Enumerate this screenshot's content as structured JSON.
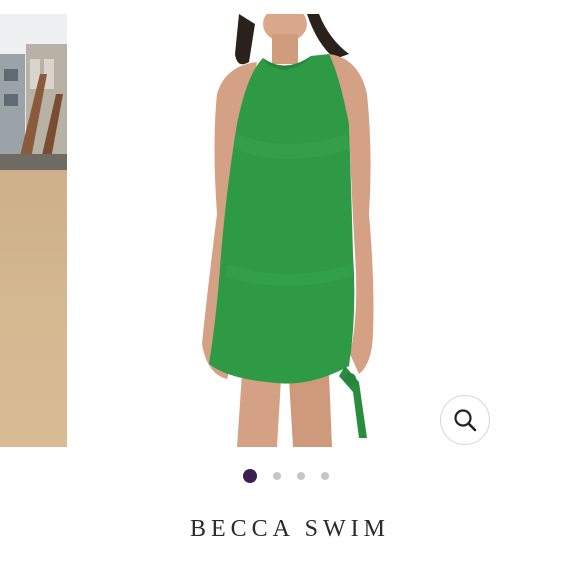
{
  "brand": {
    "name": "BECCA SWIM"
  },
  "carousel": {
    "slide_count": 4,
    "active_index": 0,
    "zoom_icon": "magnifier-icon"
  },
  "colors": {
    "dress_green": "#2f9a45",
    "active_dot": "#3b1e54",
    "inactive_dot": "#c8c4cc",
    "brand_text": "#2a2a2a"
  }
}
